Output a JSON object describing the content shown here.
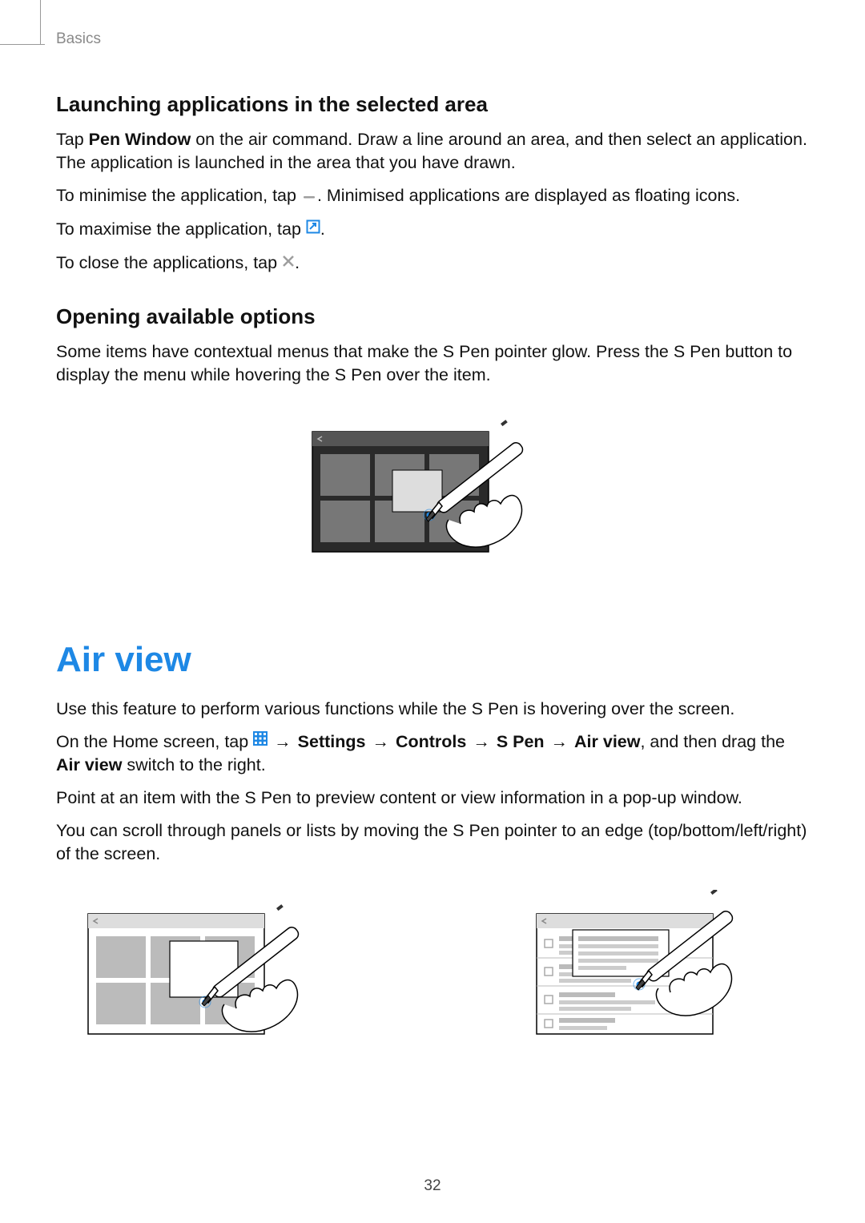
{
  "breadcrumb": "Basics",
  "section1": {
    "heading": "Launching applications in the selected area",
    "p1_pre": "Tap ",
    "p1_bold": "Pen Window",
    "p1_post": " on the air command. Draw a line around an area, and then select an application. The application is launched in the area that you have drawn.",
    "p2_pre": "To minimise the application, tap ",
    "p2_post": ". Minimised applications are displayed as floating icons.",
    "p3_pre": "To maximise the application, tap ",
    "p3_post": ".",
    "p4_pre": "To close the applications, tap ",
    "p4_post": "."
  },
  "section2": {
    "heading": "Opening available options",
    "p1": "Some items have contextual menus that make the S Pen pointer glow. Press the S Pen button to display the menu while hovering the S Pen over the item."
  },
  "airview": {
    "title": "Air view",
    "p1": "Use this feature to perform various functions while the S Pen is hovering over the screen.",
    "p2_pre": "On the Home screen, tap ",
    "p2_mid": " ",
    "settings": "Settings",
    "controls": "Controls",
    "spen": "S Pen",
    "airview_label": "Air view",
    "p2_post": ", and then drag the ",
    "airview_bold2": "Air view",
    "p2_end": " switch to the right.",
    "p3": "Point at an item with the S Pen to preview content or view information in a pop-up window.",
    "p4": "You can scroll through panels or lists by moving the S Pen pointer to an edge (top/bottom/left/right) of the screen."
  },
  "arrow": "→",
  "page_number": "32"
}
